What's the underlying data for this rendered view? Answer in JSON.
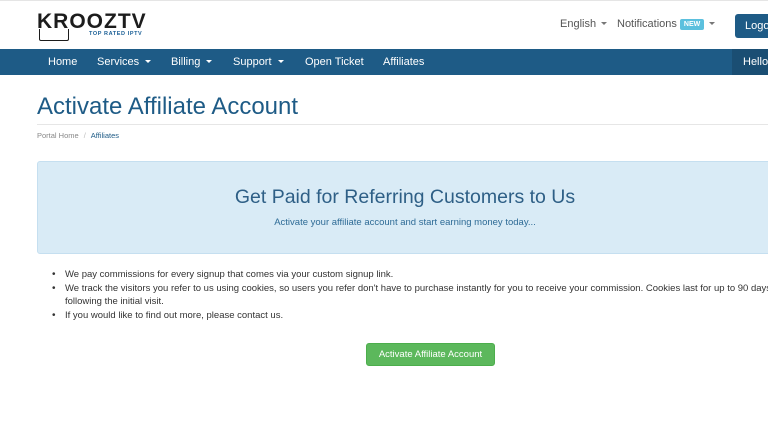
{
  "brand": {
    "name": "KROOZTV",
    "tagline": "TOP RATED IPTV"
  },
  "header": {
    "language": "English",
    "notifications": "Notifications",
    "notifications_badge": "NEW",
    "logout": "Logout"
  },
  "nav": {
    "items": [
      {
        "label": "Home",
        "has_caret": false
      },
      {
        "label": "Services",
        "has_caret": true
      },
      {
        "label": "Billing",
        "has_caret": true
      },
      {
        "label": "Support",
        "has_caret": true
      },
      {
        "label": "Open Ticket",
        "has_caret": false
      },
      {
        "label": "Affiliates",
        "has_caret": false
      }
    ],
    "user_greeting": "Hello"
  },
  "page": {
    "title": "Activate Affiliate Account",
    "breadcrumb": [
      "Portal Home",
      "Affiliates"
    ]
  },
  "promo": {
    "headline": "Get Paid for Referring Customers to Us",
    "subtext": "Activate your affiliate account and start earning money today..."
  },
  "bullets": [
    "We pay commissions for every signup that comes via your custom signup link.",
    "We track the visitors you refer to us using cookies, so users you refer don't have to purchase instantly for you to receive your commission. Cookies last for up to 90 days following the initial visit.",
    "If you would like to find out more, please contact us."
  ],
  "actions": {
    "activate_label": "Activate Affiliate Account"
  },
  "colors": {
    "primary": "#1e5b86",
    "promo_bg": "#d9ebf6",
    "success": "#5cb85c",
    "badge": "#5bc0de"
  }
}
